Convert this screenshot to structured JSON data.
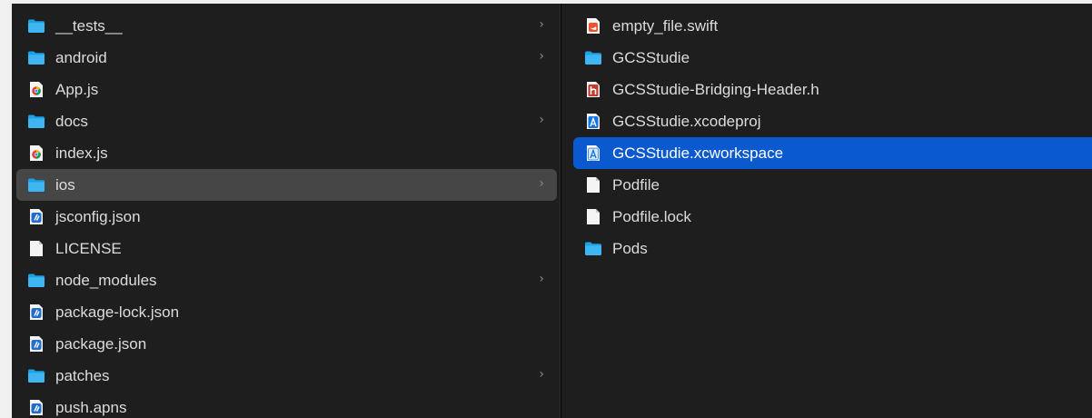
{
  "left_column": {
    "items": [
      {
        "label": "__tests__",
        "icon": "folder-icon",
        "has_children": true,
        "selected": false
      },
      {
        "label": "android",
        "icon": "folder-icon",
        "has_children": true,
        "selected": false
      },
      {
        "label": "App.js",
        "icon": "js-file-icon",
        "has_children": false,
        "selected": false
      },
      {
        "label": "docs",
        "icon": "folder-icon",
        "has_children": true,
        "selected": false
      },
      {
        "label": "index.js",
        "icon": "js-file-icon",
        "has_children": false,
        "selected": false
      },
      {
        "label": "ios",
        "icon": "folder-icon",
        "has_children": true,
        "selected": "inactive"
      },
      {
        "label": "jsconfig.json",
        "icon": "json-file-icon",
        "has_children": false,
        "selected": false
      },
      {
        "label": "LICENSE",
        "icon": "document-icon",
        "has_children": false,
        "selected": false
      },
      {
        "label": "node_modules",
        "icon": "folder-icon",
        "has_children": true,
        "selected": false
      },
      {
        "label": "package-lock.json",
        "icon": "json-file-icon",
        "has_children": false,
        "selected": false
      },
      {
        "label": "package.json",
        "icon": "json-file-icon",
        "has_children": false,
        "selected": false
      },
      {
        "label": "patches",
        "icon": "folder-icon",
        "has_children": true,
        "selected": false
      },
      {
        "label": "push.apns",
        "icon": "json-file-icon",
        "has_children": false,
        "selected": false
      }
    ]
  },
  "right_column": {
    "items": [
      {
        "label": "empty_file.swift",
        "icon": "swift-file-icon",
        "has_children": false,
        "selected": false
      },
      {
        "label": "GCSStudie",
        "icon": "folder-icon",
        "has_children": true,
        "selected": false
      },
      {
        "label": "GCSStudie-Bridging-Header.h",
        "icon": "header-file-icon",
        "has_children": false,
        "selected": false
      },
      {
        "label": "GCSStudie.xcodeproj",
        "icon": "xcodeproj-icon",
        "has_children": false,
        "selected": false
      },
      {
        "label": "GCSStudie.xcworkspace",
        "icon": "xcworkspace-icon",
        "has_children": false,
        "selected": "active"
      },
      {
        "label": "Podfile",
        "icon": "document-icon",
        "has_children": false,
        "selected": false
      },
      {
        "label": "Podfile.lock",
        "icon": "document-icon",
        "has_children": false,
        "selected": false
      },
      {
        "label": "Pods",
        "icon": "folder-icon",
        "has_children": true,
        "selected": false
      }
    ]
  },
  "chevron_glyph": "›",
  "colors": {
    "window_bg": "#1e1e1e",
    "selection_active": "#0a59cf",
    "selection_inactive": "#464646",
    "folder": "#1aa1e6",
    "text": "#dcdcdc"
  }
}
